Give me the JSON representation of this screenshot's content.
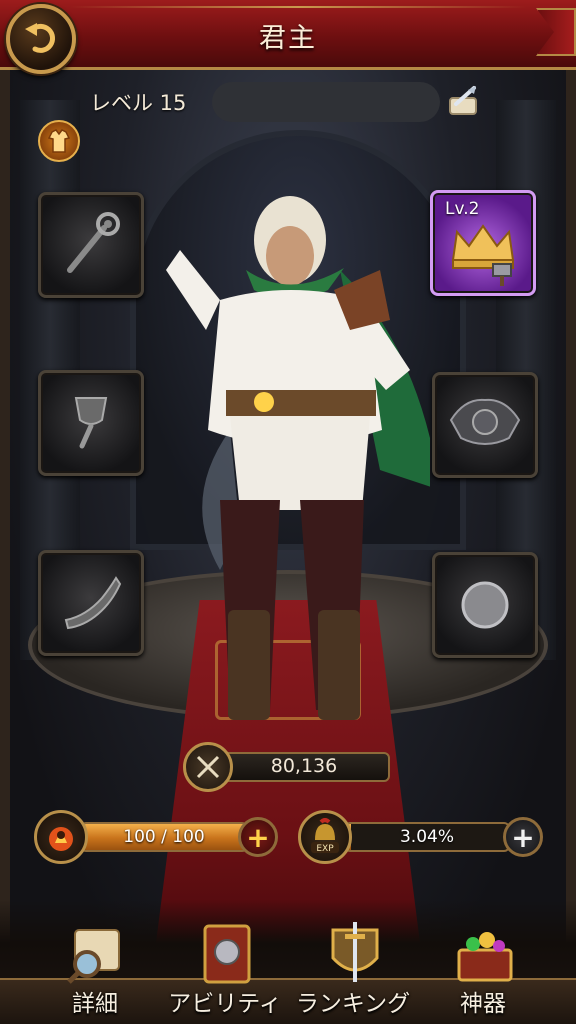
{
  "header": {
    "title": "君主"
  },
  "profile": {
    "level_label": "レベル 15"
  },
  "slots": {
    "crown_level": "Lv.2"
  },
  "power": {
    "value": "80,136"
  },
  "stamina": {
    "text": "100 / 100",
    "fraction": 1.0
  },
  "experience": {
    "text": "3.04%",
    "fraction": 0.0304,
    "icon_label": "EXP"
  },
  "nav": [
    {
      "label": "詳細"
    },
    {
      "label": "アビリティ"
    },
    {
      "label": "ランキング"
    },
    {
      "label": "神器"
    }
  ],
  "colors": {
    "accent_gold": "#b8904a",
    "header_red": "#8b1a1a",
    "crown_slot_purple": "#8a3ac0"
  }
}
